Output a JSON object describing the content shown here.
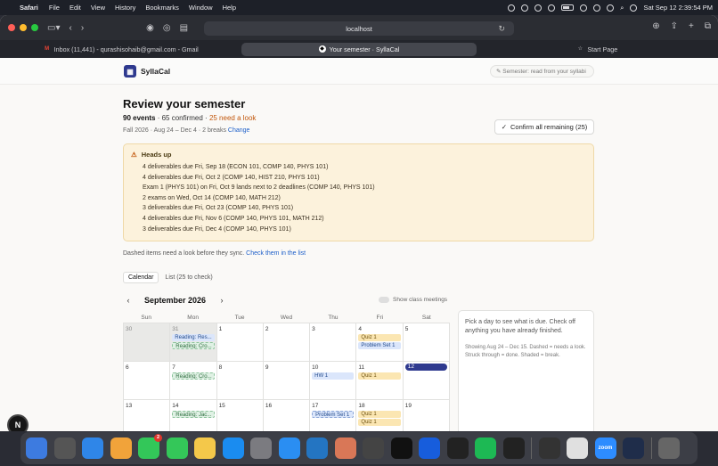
{
  "menubar": {
    "app": "Safari",
    "items": [
      "File",
      "Edit",
      "View",
      "History",
      "Bookmarks",
      "Window",
      "Help"
    ],
    "clock": "Sat Sep 12  2:39:54 PM"
  },
  "browser": {
    "url": "localhost",
    "tabs": [
      {
        "label": "Inbox (11,441) - qurashisohaib@gmail.com - Gmail"
      },
      {
        "label": "Your semester · SyllaCal",
        "active": true
      },
      {
        "label": "Start Page"
      }
    ]
  },
  "app": {
    "name": "SyllaCal",
    "semester_pill": "Semester: read from your syllabi"
  },
  "review": {
    "title": "Review your semester",
    "events": "90 events",
    "confirmed": "65 confirmed",
    "need_look": "25 need a look",
    "term": "Fall 2026 · Aug 24 – Dec 4 · 2 breaks",
    "change": "Change",
    "confirm_btn": "Confirm all remaining (25)"
  },
  "heads_up": {
    "title": "Heads up",
    "items": [
      "4 deliverables due Fri, Sep 18 (ECON 101, COMP 140, PHYS 101)",
      "4 deliverables due Fri, Oct 2 (COMP 140, HIST 210, PHYS 101)",
      "Exam 1 (PHYS 101) on Fri, Oct 9 lands next to 2 deadlines (COMP 140, PHYS 101)",
      "2 exams on Wed, Oct 14 (COMP 140, MATH 212)",
      "3 deliverables due Fri, Oct 23 (COMP 140, PHYS 101)",
      "4 deliverables due Fri, Nov 6 (COMP 140, PHYS 101, MATH 212)",
      "3 deliverables due Fri, Dec 4 (COMP 140, PHYS 101)"
    ]
  },
  "dashed_note": {
    "text": "Dashed items need a look before they sync.",
    "link": "Check them in the list"
  },
  "view_tabs": {
    "calendar": "Calendar",
    "list": "List (25 to check)"
  },
  "calendar": {
    "month": "September 2026",
    "prev": "‹",
    "next": "›",
    "toggle_label": "Show class meetings",
    "weekdays": [
      "Sun",
      "Mon",
      "Tue",
      "Wed",
      "Thu",
      "Fri",
      "Sat"
    ]
  },
  "sidebar": {
    "hint": "Pick a day to see what is due. Check off anything you have already finished.",
    "legend": "Showing Aug 24 – Dec 15. Dashed = needs a look. Struck through = done. Shaded = break."
  },
  "colors": {
    "accent": "#2f3a8f",
    "warning": "#c2570c",
    "headsup_bg": "#fcf2dc"
  },
  "dock": {
    "apps": [
      "finder",
      "launchpad",
      "mail",
      "photos",
      "messages",
      "facetime",
      "notes",
      "app-store",
      "system-settings",
      "safari",
      "vscode",
      "claude",
      "files",
      "github",
      "bitwarden",
      "x",
      "spotify",
      "chatgpt",
      "activity-monitor",
      "chrome",
      "zoom",
      "quicktime",
      "trash"
    ],
    "messages_badge": "2",
    "zoom_label": "zoom"
  }
}
